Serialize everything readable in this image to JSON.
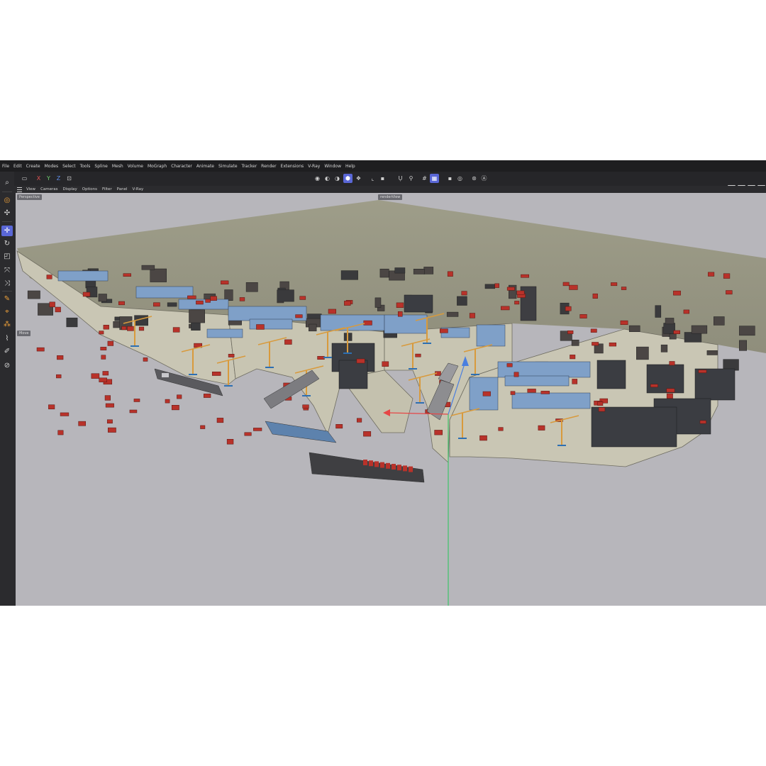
{
  "menu": [
    "File",
    "Edit",
    "Create",
    "Modes",
    "Select",
    "Tools",
    "Spline",
    "Mesh",
    "Volume",
    "MoGraph",
    "Character",
    "Animate",
    "Simulate",
    "Tracker",
    "Render",
    "Extensions",
    "V-Ray",
    "Window",
    "Help"
  ],
  "toolbar": {
    "axis_x": "X",
    "axis_y": "Y",
    "axis_z": "Z"
  },
  "view_menu": [
    "View",
    "Cameras",
    "Display",
    "Options",
    "Filter",
    "Panel",
    "V-Ray"
  ],
  "viewport": {
    "camera_label": "Perspective",
    "render_label": "renderView",
    "tool_label": "Move"
  },
  "colors": {
    "accent": "#5a67d6",
    "ground": "#a6a58f",
    "background": "#b7b6bb",
    "container": "#b8322a",
    "crane": "#d89a3c"
  }
}
